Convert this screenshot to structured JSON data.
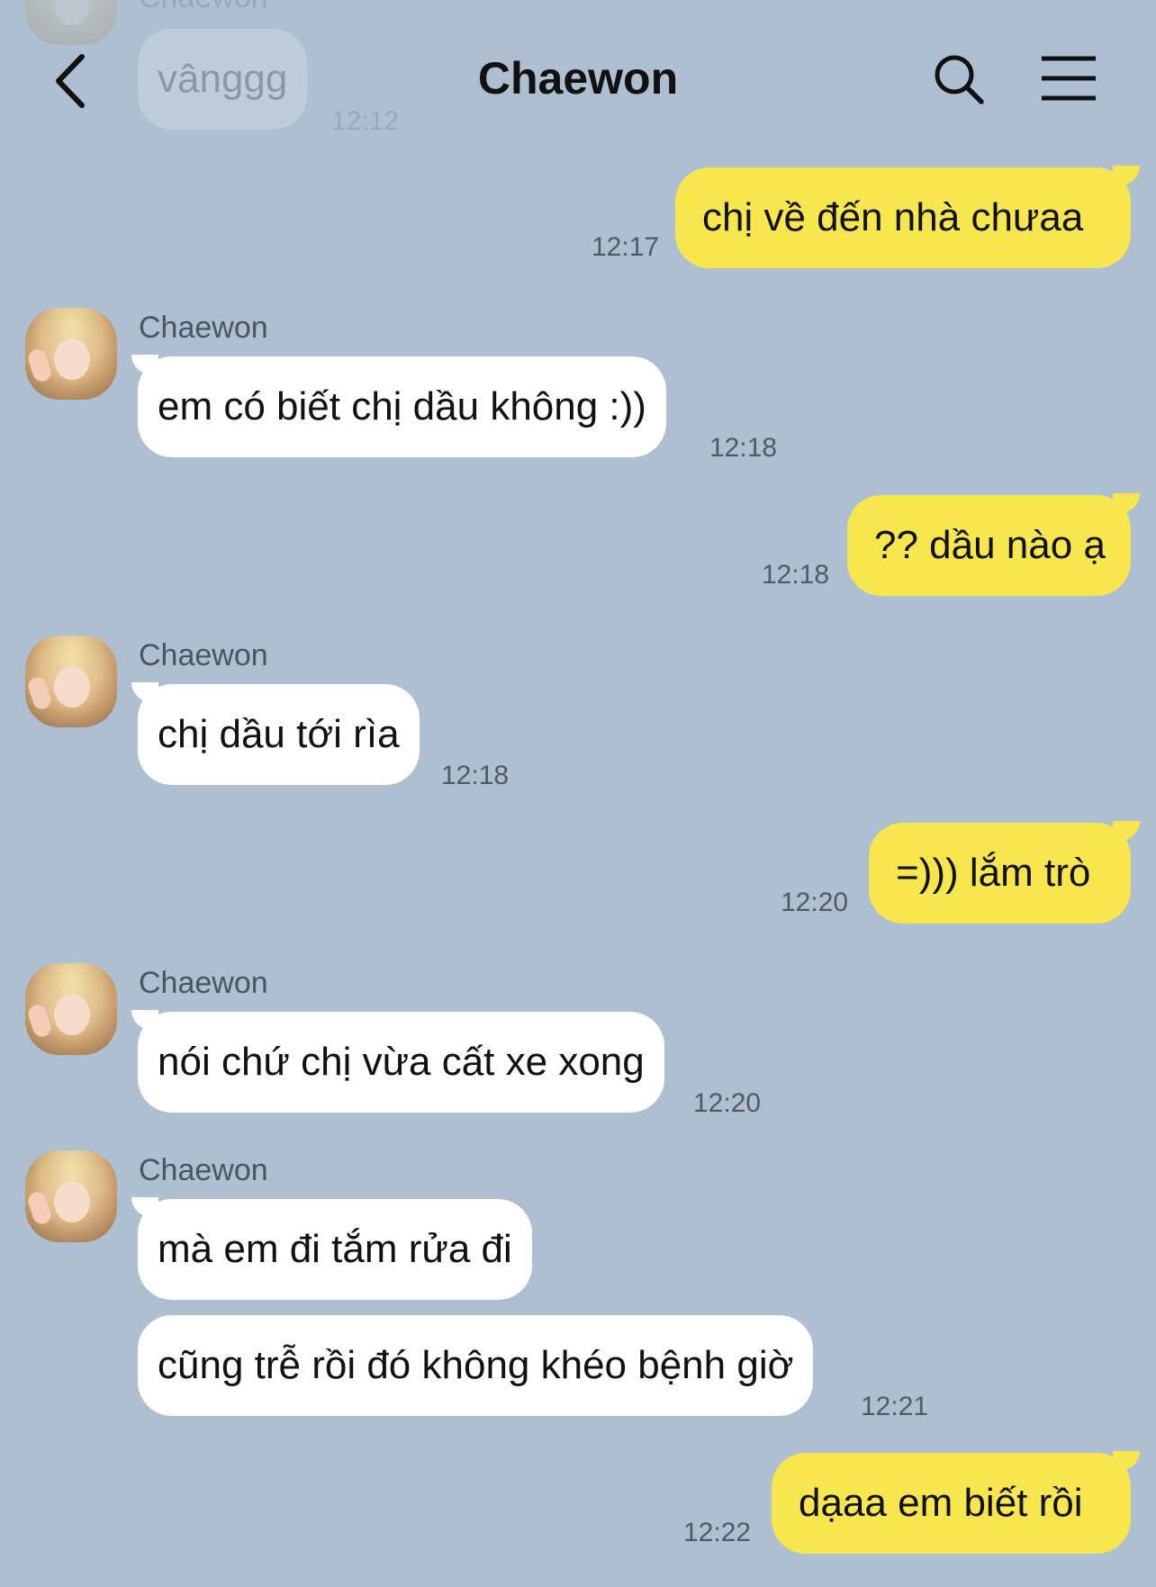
{
  "header": {
    "title": "Chaewon"
  },
  "previous": {
    "sender": "Chaewon",
    "text": "vânggg",
    "time": "12:12"
  },
  "messages": [
    {
      "dir": "out",
      "text": "chị về đến nhà chưaa",
      "time": "12:17"
    },
    {
      "dir": "in",
      "sender": "Chaewon",
      "text": "em có biết chị dầu không :))",
      "time": "12:18"
    },
    {
      "dir": "out",
      "text": "?? dầu nào ạ",
      "time": "12:18"
    },
    {
      "dir": "in",
      "sender": "Chaewon",
      "text": "chị dầu tới rìa",
      "time": "12:18"
    },
    {
      "dir": "out",
      "text": "=))) lắm trò",
      "time": "12:20"
    },
    {
      "dir": "in",
      "sender": "Chaewon",
      "text": "nói chứ chị vừa cất xe xong",
      "time": "12:20"
    },
    {
      "dir": "in",
      "sender": "Chaewon",
      "text": "mà em đi tắm rửa đi",
      "time": ""
    },
    {
      "dir": "in",
      "text": "cũng trễ rồi đó không khéo bệnh giờ",
      "time": "12:21"
    },
    {
      "dir": "out",
      "text": "dạaa em biết rồi",
      "time": "12:22"
    }
  ]
}
